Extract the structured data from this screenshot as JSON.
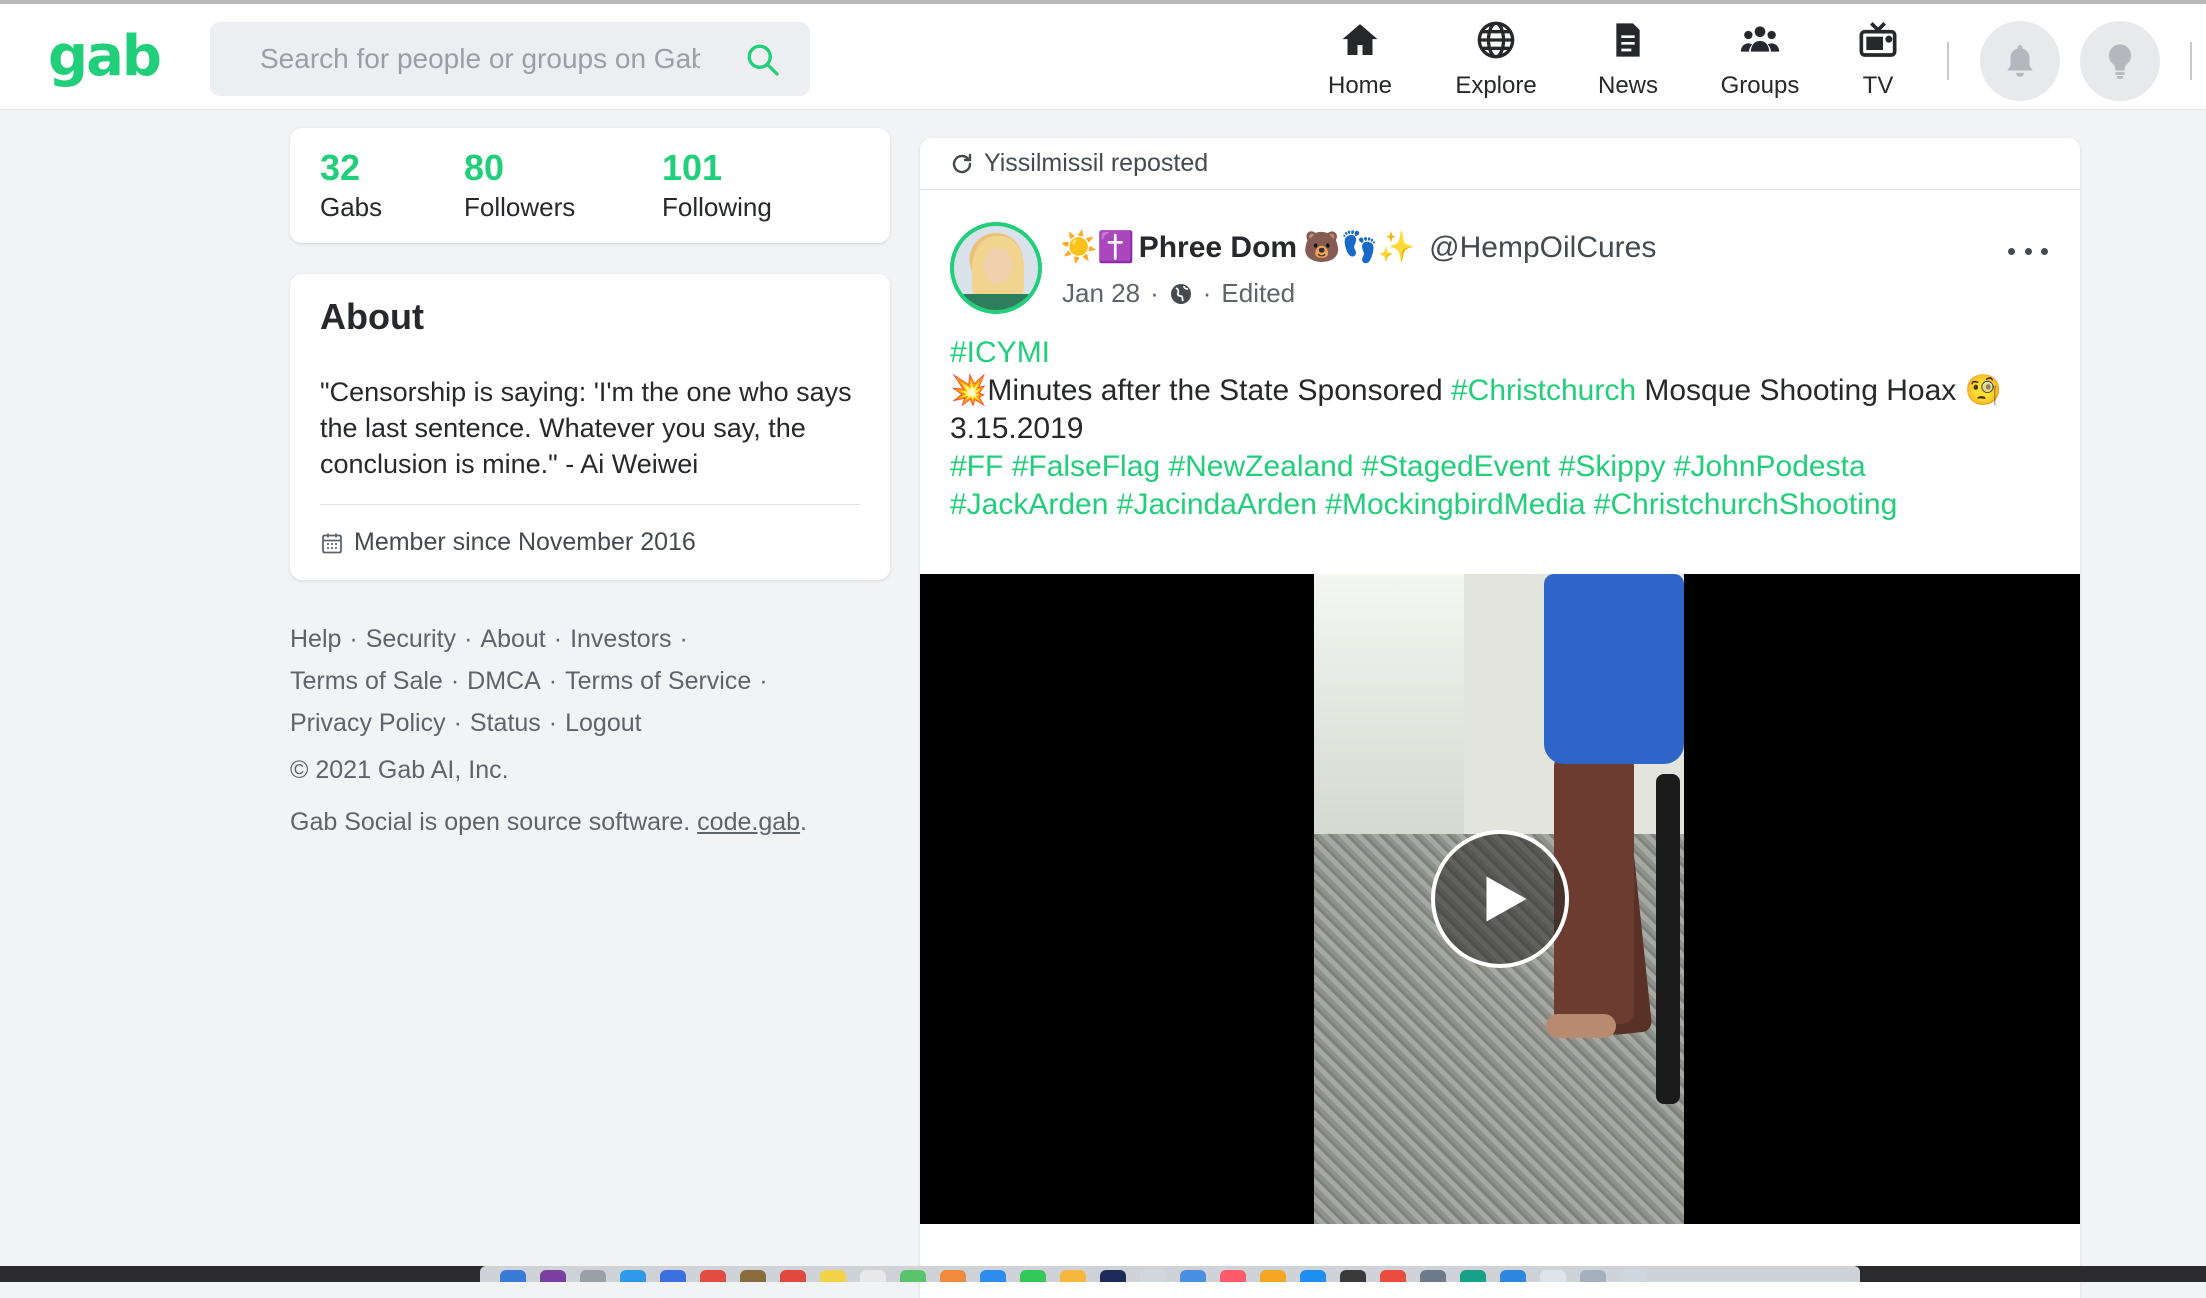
{
  "header": {
    "logo": "gab",
    "search": {
      "placeholder": "Search for people or groups on Gab",
      "icon": "search-icon"
    },
    "nav": [
      {
        "label": "Home",
        "icon": "home-icon"
      },
      {
        "label": "Explore",
        "icon": "globe-icon"
      },
      {
        "label": "News",
        "icon": "news-icon"
      },
      {
        "label": "Groups",
        "icon": "groups-icon"
      },
      {
        "label": "TV",
        "icon": "tv-icon"
      }
    ],
    "buttons": [
      {
        "icon": "bell-icon"
      },
      {
        "icon": "lightbulb-icon"
      }
    ]
  },
  "profile_stats": [
    {
      "value": "32",
      "label": "Gabs"
    },
    {
      "value": "80",
      "label": "Followers"
    },
    {
      "value": "101",
      "label": "Following"
    }
  ],
  "about": {
    "title": "About",
    "bio": "\"Censorship is saying: 'I'm the one who says the last sentence. Whatever you say, the conclusion is mine.\" - Ai Weiwei",
    "member_since": "Member since November 2016"
  },
  "footer": {
    "links": [
      "Help",
      "Security",
      "About",
      "Investors",
      "Terms of Sale",
      "DMCA",
      "Terms of Service",
      "Privacy Policy",
      "Status",
      "Logout"
    ],
    "copyright": "© 2021 Gab AI, Inc.",
    "oss_text": "Gab Social is open source software.",
    "oss_link": "code.gab",
    "oss_end": "."
  },
  "post": {
    "repost_text": "Yissilmissil reposted",
    "author": {
      "prefix_emoji": "☀️✝️",
      "name": "Phree Dom",
      "suffix_emoji": "🐻👣✨",
      "handle": "@HempOilCures"
    },
    "date": "Jan 28",
    "visibility_icon": "globe-icon",
    "edited": "Edited",
    "content": {
      "line1_tag": "#ICYMI",
      "line2_emoji": "💥",
      "line2_a": "Minutes after the State Sponsored ",
      "line2_tag": "#Christchurch",
      "line2_b": " Mosque Shooting Hoax ",
      "line2_end_emoji": "🧐",
      "line3": "3.15.2019",
      "tags_row1": [
        "#FF",
        "#FalseFlag",
        "#NewZealand",
        "#StagedEvent",
        "#Skippy",
        "#JohnPodesta"
      ],
      "tags_row2": [
        "#JackArden",
        "#JacindaArden",
        "#MockingbirdMedia",
        "#ChristchurchShooting"
      ]
    },
    "video": {
      "play_icon": "play-icon"
    }
  },
  "colors": {
    "accent": "#21cf7a",
    "text": "#26282b",
    "muted": "#5f646b",
    "background": "#f2f3f5"
  }
}
